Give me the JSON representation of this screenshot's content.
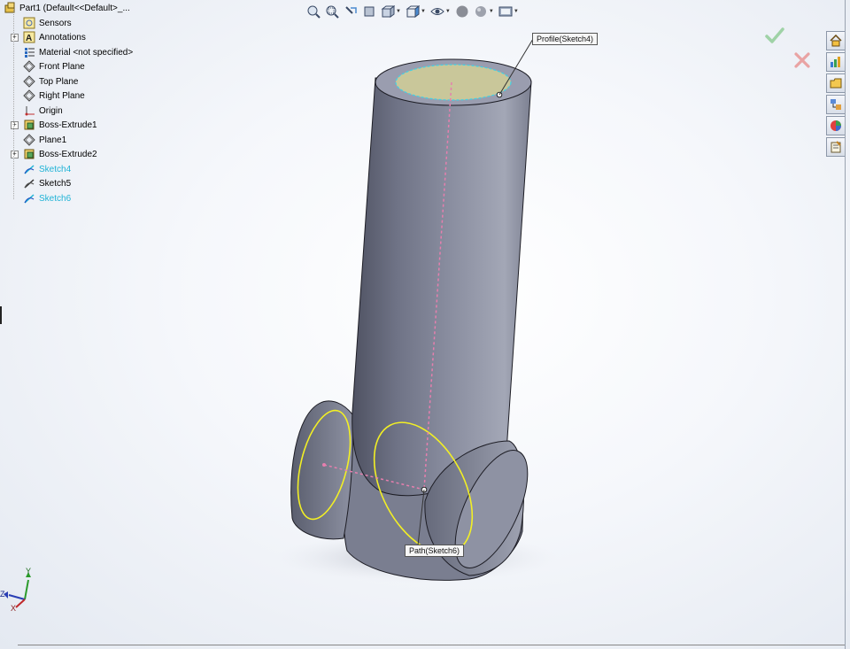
{
  "feature_tree": {
    "items": [
      {
        "label": "Part1  (Default<<Default>_...",
        "icon": "part-icon",
        "selected": false
      },
      {
        "label": "Sensors",
        "icon": "sensor-icon",
        "selected": false
      },
      {
        "label": "Annotations",
        "icon": "annotations-icon",
        "selected": false
      },
      {
        "label": "Material <not specified>",
        "icon": "material-icon",
        "selected": false
      },
      {
        "label": "Front Plane",
        "icon": "plane-icon",
        "selected": false
      },
      {
        "label": "Top Plane",
        "icon": "plane-icon",
        "selected": false
      },
      {
        "label": "Right Plane",
        "icon": "plane-icon",
        "selected": false
      },
      {
        "label": "Origin",
        "icon": "origin-icon",
        "selected": false
      },
      {
        "label": "Boss-Extrude1",
        "icon": "extrude-icon",
        "selected": false
      },
      {
        "label": "Plane1",
        "icon": "plane-icon",
        "selected": false
      },
      {
        "label": "Boss-Extrude2",
        "icon": "extrude-icon",
        "selected": false
      },
      {
        "label": "Sketch4",
        "icon": "sketch-icon",
        "selected": true
      },
      {
        "label": "Sketch5",
        "icon": "sketch-icon",
        "selected": false
      },
      {
        "label": "Sketch6",
        "icon": "sketch-icon",
        "selected": true
      }
    ]
  },
  "view_toolbar": {
    "icons": [
      "zoom-to-fit-icon",
      "zoom-area-icon",
      "previous-view-icon",
      "section-view-icon",
      "view-orientation-icon",
      "display-style-icon",
      "hide-show-icon",
      "edit-appearance-icon",
      "apply-scene-icon",
      "view-settings-icon"
    ]
  },
  "property_manager": {
    "ok_icon": "checkmark-icon",
    "cancel_icon": "close-icon"
  },
  "task_pane": {
    "tabs": [
      "home-icon",
      "resources-icon",
      "design-library-icon",
      "file-explorer-icon",
      "appearances-icon",
      "custom-properties-icon"
    ]
  },
  "callouts": {
    "profile": "Profile(Sketch4)",
    "path": "Path(Sketch6)"
  },
  "triad": {
    "y_label": "Y",
    "z_label": "Z",
    "x_label": "X"
  },
  "colors": {
    "model_body": "#7d8092",
    "profile_face": "#c9c79a",
    "path_sketch": "#e67fae",
    "selected_edge": "#f2ef25",
    "selected_tree_text": "#1fb3d6"
  }
}
